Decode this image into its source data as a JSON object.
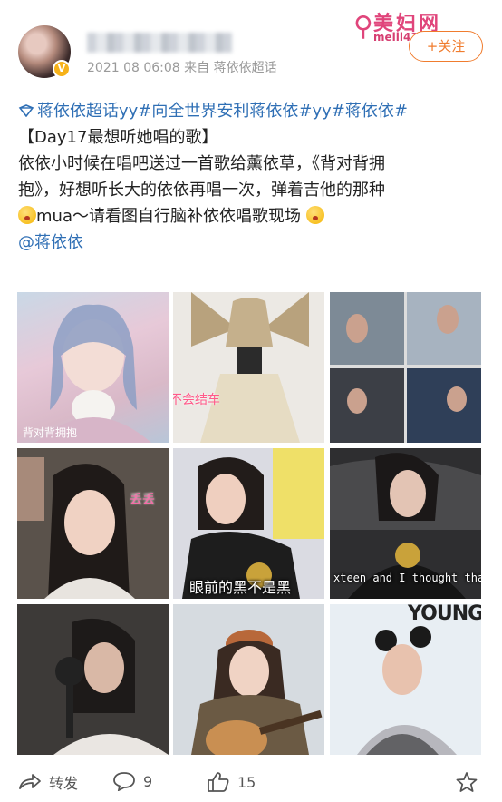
{
  "watermark": {
    "title": "美妇网",
    "url": "meili43.com"
  },
  "post": {
    "username": "B",
    "meta_time": "2021 08 06:08",
    "meta_source": "来自 蒋依依超话",
    "follow_label": "+关注"
  },
  "content": {
    "topic_super": "蒋依依超话",
    "topic_rest": "yy#向全世界安利蒋依依#yy#蒋依依#",
    "title": "【Day17最想听她唱的歌】",
    "line1": "依依小时候在唱吧送过一首歌给薰依草，《背对背拥",
    "line2": "抱》，好想听长大的依依再唱一次，弹着吉他的那种",
    "line3": "mua～请看图自行脑补依依唱歌现场",
    "mention": "@蒋依依"
  },
  "images": [
    {
      "name": "anime-girl",
      "caption": "",
      "sub": "背对背拥抱"
    },
    {
      "name": "dress-photo",
      "caption": "不会结车"
    },
    {
      "name": "collage",
      "caption": ""
    },
    {
      "name": "makeup",
      "caption": "丢丢"
    },
    {
      "name": "gesture",
      "caption": "眼前的黑不是黑"
    },
    {
      "name": "sofa",
      "caption": "xteen and I thought that you a b"
    },
    {
      "name": "singing",
      "caption": ""
    },
    {
      "name": "guitar",
      "caption": ""
    },
    {
      "name": "young",
      "caption": "YOUNG"
    }
  ],
  "actions": {
    "repost_label": "转发",
    "comment_count": "9",
    "like_count": "15"
  },
  "colors": {
    "topic": "#2f6fb5",
    "accent": "#f07c2e",
    "watermark": "#e0457b"
  }
}
